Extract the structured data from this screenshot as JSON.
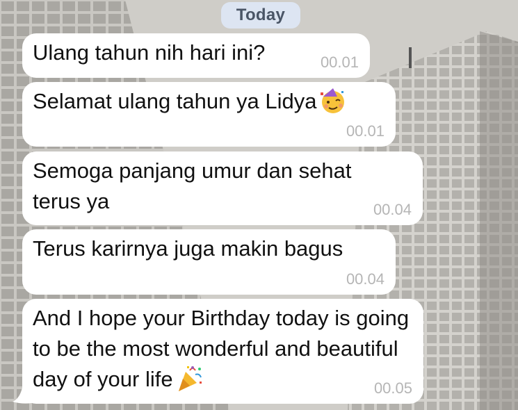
{
  "chat": {
    "date_label": "Today",
    "messages": [
      {
        "text": "Ulang tahun nih hari ini?",
        "time": "00.01"
      },
      {
        "text": "Selamat ulang tahun ya Lidya",
        "emoji": "partying-face-icon",
        "time": "00.01"
      },
      {
        "text": "Semoga panjang umur dan sehat terus ya",
        "time": "00.04"
      },
      {
        "text": "Terus karirnya juga makin bagus",
        "time": "00.04"
      },
      {
        "text": "And I hope your Birthday today is going to be the most wonderful and beautiful day of your life",
        "emoji": "party-popper-icon",
        "time": "00.05"
      }
    ]
  },
  "colors": {
    "bubble": "#ffffff",
    "date_pill": "#dde5f2",
    "timestamp": "#b5b5b5"
  }
}
